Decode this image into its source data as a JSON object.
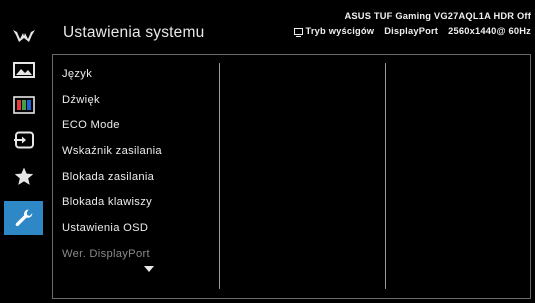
{
  "header": {
    "title": "Ustawienia systemu",
    "monitor_model": "ASUS TUF Gaming  VG27AQL1A HDR Off",
    "mode": "Tryb wyścigów",
    "input": "DisplayPort",
    "resolution": "2560x1440@ 60Hz"
  },
  "sidebar": {
    "items": [
      {
        "icon": "tuf-gaming-logo-icon",
        "active": false
      },
      {
        "icon": "image-icon",
        "active": false
      },
      {
        "icon": "color-bars-icon",
        "active": false
      },
      {
        "icon": "input-select-icon",
        "active": false
      },
      {
        "icon": "star-icon",
        "active": false
      },
      {
        "icon": "wrench-icon",
        "active": true
      }
    ]
  },
  "menu": {
    "items": [
      {
        "label": "Język",
        "enabled": true
      },
      {
        "label": "Dźwięk",
        "enabled": true
      },
      {
        "label": "ECO Mode",
        "enabled": true
      },
      {
        "label": "Wskaźnik zasilania",
        "enabled": true
      },
      {
        "label": "Blokada zasilania",
        "enabled": true
      },
      {
        "label": "Blokada klawiszy",
        "enabled": true
      },
      {
        "label": "Ustawienia OSD",
        "enabled": true
      },
      {
        "label": "Wer. DisplayPort",
        "enabled": false
      }
    ],
    "more_indicator": "scroll-down-arrow-icon"
  },
  "colors": {
    "background": "#000000",
    "accent": "#2f88c6",
    "text": "#ececec",
    "text_dim": "#8a8a8a",
    "border": "#6a6a6a"
  }
}
